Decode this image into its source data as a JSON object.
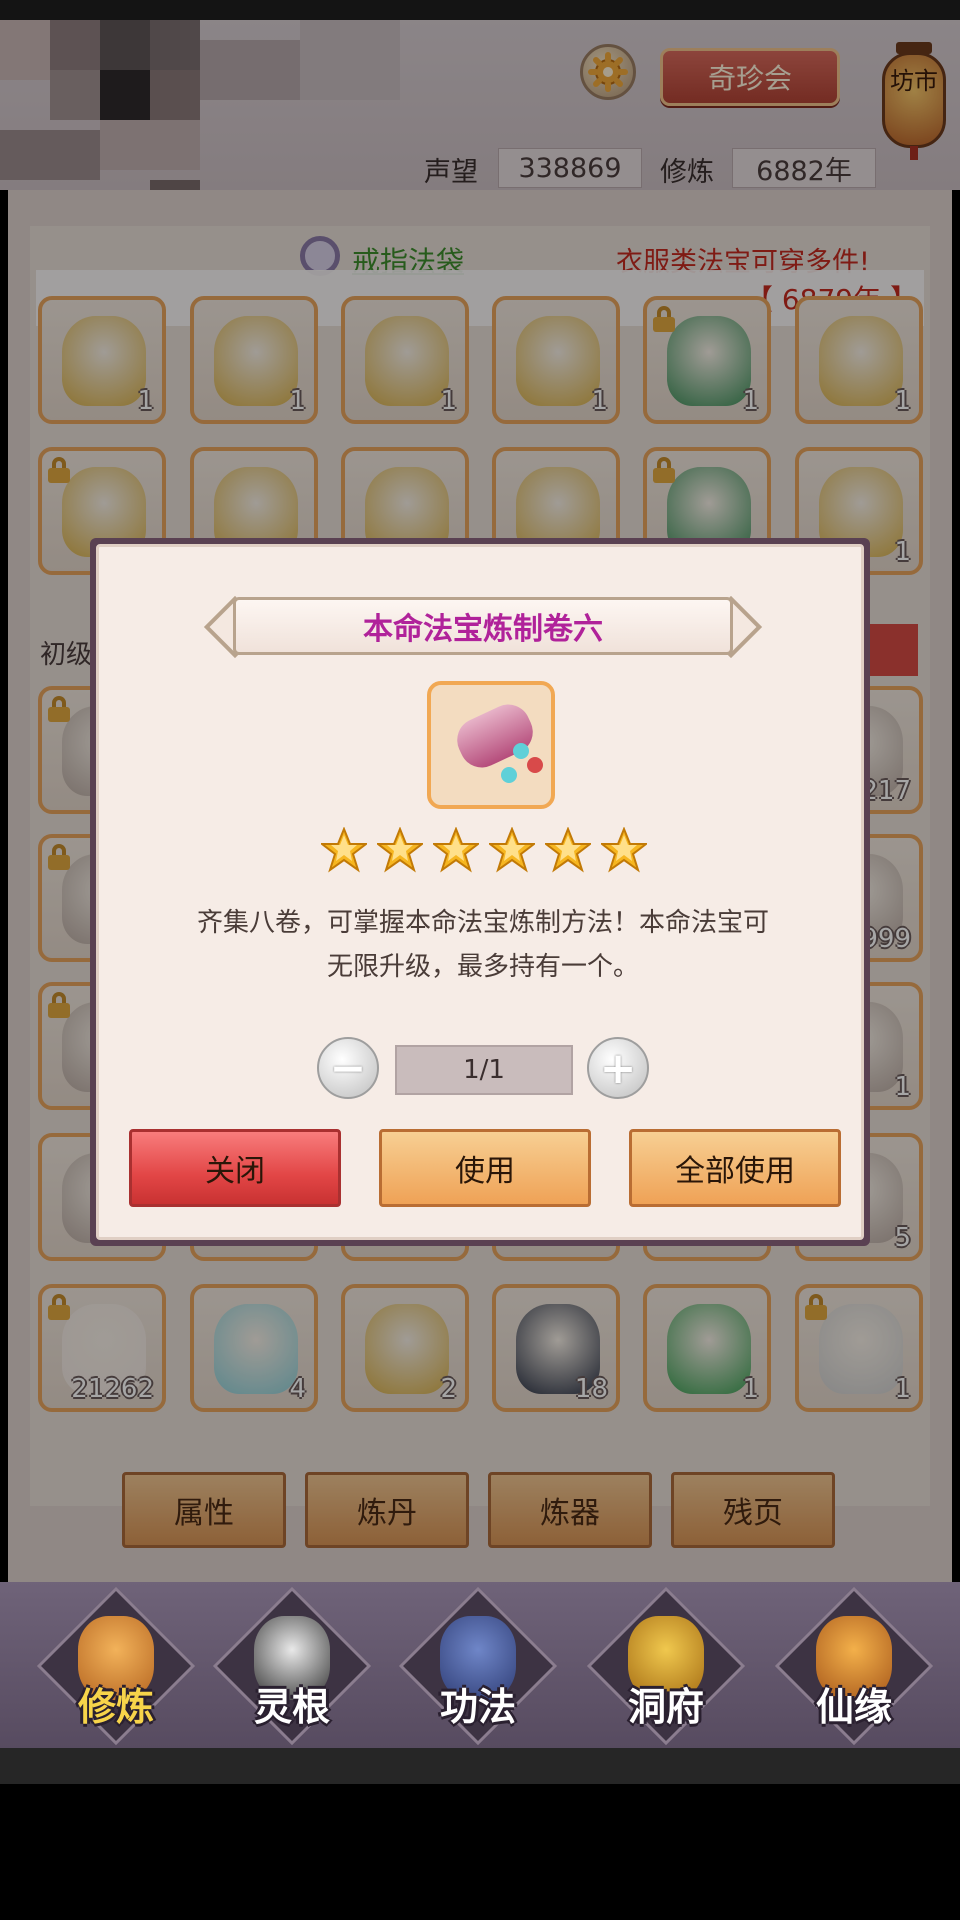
{
  "header": {
    "qizhen_label": "奇珍会",
    "fangshi_label": "坊市",
    "reputation_label": "声望",
    "reputation_value": "338869",
    "cultivation_label": "修炼",
    "cultivation_value": "6882年"
  },
  "inventory": {
    "tab_label": "戒指法袋",
    "warning": "衣服类法宝可穿多件!",
    "notice_year": "【 6879年 】",
    "section_label": "初级",
    "row1_counts": [
      "1",
      "1",
      "1",
      "1",
      "1",
      "1"
    ],
    "row2_counts": [
      "",
      "",
      "",
      "",
      "",
      "1"
    ],
    "row3_counts": [
      "",
      "",
      "",
      "",
      "",
      "217"
    ],
    "row4_counts": [
      "",
      "",
      "",
      "",
      "",
      "999"
    ],
    "row5_counts": [
      "",
      "",
      "",
      "",
      "",
      "1"
    ],
    "row6_counts": [
      "",
      "",
      "",
      "",
      "",
      "5"
    ],
    "row7_counts": [
      "21262",
      "4",
      "2",
      "18",
      "1",
      "1"
    ]
  },
  "bottom_buttons": [
    "属性",
    "炼丹",
    "炼器",
    "残页"
  ],
  "nav": [
    {
      "label": "修炼",
      "active": true
    },
    {
      "label": "灵根",
      "active": false
    },
    {
      "label": "功法",
      "active": false
    },
    {
      "label": "洞府",
      "active": false
    },
    {
      "label": "仙缘",
      "active": false
    }
  ],
  "modal": {
    "title": "本命法宝炼制卷六",
    "stars": 6,
    "description_line1": "齐集八卷，可掌握本命法宝炼制方法！本命法宝可",
    "description_line2": "无限升级，最多持有一个。",
    "quantity": "1/1",
    "close_label": "关闭",
    "use_label": "使用",
    "use_all_label": "全部使用"
  },
  "colors": {
    "accent_orange": "#efa256",
    "close_red": "#e24646",
    "title_magenta": "#b0229a",
    "warning_red": "#c42a20"
  }
}
